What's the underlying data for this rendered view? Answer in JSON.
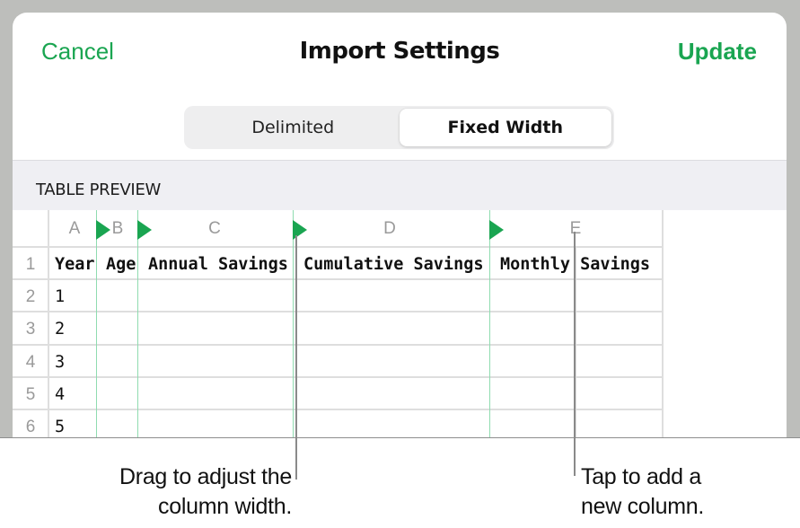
{
  "nav": {
    "cancel_label": "Cancel",
    "title": "Import Settings",
    "update_label": "Update"
  },
  "segmented_control": {
    "options": [
      "Delimited",
      "Fixed Width"
    ],
    "selected": "Fixed Width"
  },
  "section_header": "TABLE PREVIEW",
  "table": {
    "column_letters": [
      "A",
      "B",
      "C",
      "D",
      "E"
    ],
    "row_numbers": [
      "1",
      "2",
      "3",
      "4",
      "5",
      "6"
    ],
    "header_row": [
      "Year",
      "Age",
      "Annual Savings",
      "Cumulative Savings",
      "Monthly Savings"
    ],
    "year_values": [
      "1",
      "2",
      "3",
      "4",
      "5"
    ]
  },
  "colors": {
    "accent": "#1aa551",
    "column_divider": "#8fdcb0",
    "backdrop": "#bdbebb"
  },
  "callouts": {
    "drag": "Drag to adjust the column width.",
    "drag_lines": [
      "Drag to adjust the",
      "column width."
    ],
    "tap": "Tap to add a new column.",
    "tap_lines": [
      "Tap to add a",
      "new column."
    ]
  }
}
